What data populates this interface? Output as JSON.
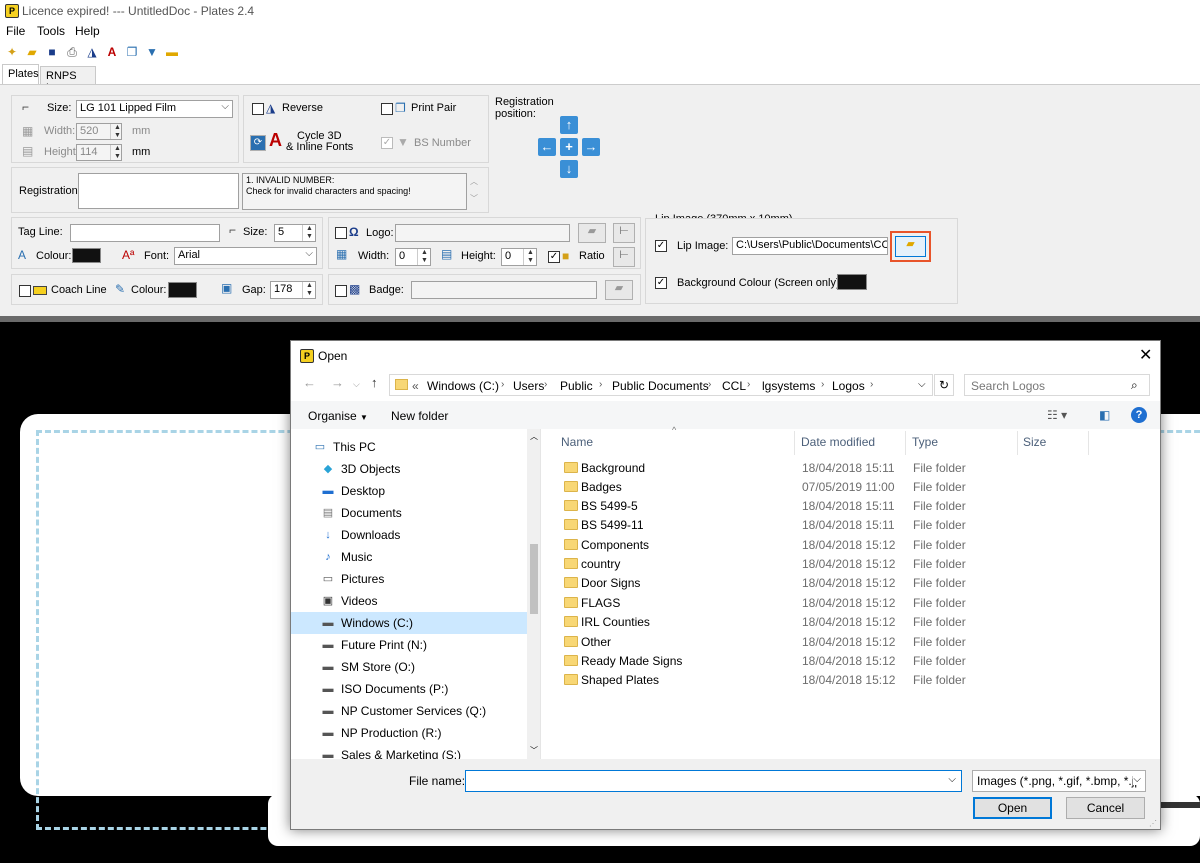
{
  "app": {
    "title": "Licence expired! --- UntitledDoc - Plates 2.4",
    "icon_letter": "P",
    "menu": [
      "File",
      "Tools",
      "Help"
    ]
  },
  "tabs": [
    "Plates",
    "RNPS Log"
  ],
  "plate_settings": {
    "size_label": "Size:",
    "size_value": "LG 101 Lipped Film",
    "width_label": "Width:",
    "width_value": "520",
    "height_label": "Height:",
    "height_value": "114",
    "unit": "mm",
    "reverse_label": "Reverse",
    "print_pair_label": "Print Pair",
    "cycle_label_1": "Cycle 3D",
    "cycle_label_2": "& Inline Fonts",
    "bs_number_label": "BS Number",
    "registration_position_label_1": "Registration",
    "registration_position_label_2": "position:",
    "registration_label": "Registration:",
    "registration_value": "",
    "error_line_1": "1. INVALID NUMBER:",
    "error_line_2": "Check for invalid characters and spacing!",
    "tag_line_label": "Tag Line:",
    "tag_line_value": "",
    "tag_size_label": "Size:",
    "tag_size_value": "5",
    "colour_label": "Colour:",
    "font_label": "Font:",
    "font_value": "Arial",
    "coach_line_label": "Coach Line",
    "coach_colour_label": "Colour:",
    "gap_label": "Gap:",
    "gap_value": "178",
    "logo_label": "Logo:",
    "logo_width_label": "Width:",
    "logo_width_value": "0",
    "logo_height_label": "Height:",
    "logo_height_value": "0",
    "ratio_label": "Ratio",
    "badge_label": "Badge:",
    "lip_image_group": "Lip Image (370mm x 10mm)",
    "lip_image_label": "Lip Image:",
    "lip_image_path": "C:\\Users\\Public\\Documents\\CCL\\",
    "background_colour_label": "Background Colour (Screen only):",
    "swatch_color": "#111111"
  },
  "open_dialog": {
    "title": "Open",
    "breadcrumbs": [
      "«",
      "Windows (C:)",
      "Users",
      "Public",
      "Public Documents",
      "CCL",
      "lgsystems",
      "Logos"
    ],
    "search_placeholder": "Search Logos",
    "organise_label": "Organise",
    "new_folder_label": "New folder",
    "nav_items": [
      {
        "label": "This PC",
        "icon": "computer-icon"
      },
      {
        "label": "3D Objects",
        "icon": "cube-icon"
      },
      {
        "label": "Desktop",
        "icon": "desktop-icon"
      },
      {
        "label": "Documents",
        "icon": "document-icon"
      },
      {
        "label": "Downloads",
        "icon": "download-icon"
      },
      {
        "label": "Music",
        "icon": "music-icon"
      },
      {
        "label": "Pictures",
        "icon": "picture-icon"
      },
      {
        "label": "Videos",
        "icon": "video-icon"
      },
      {
        "label": "Windows (C:)",
        "icon": "drive-icon"
      },
      {
        "label": "Future Print (N:)",
        "icon": "network-drive-icon"
      },
      {
        "label": "SM Store (O:)",
        "icon": "network-drive-icon"
      },
      {
        "label": "ISO Documents (P:)",
        "icon": "network-drive-icon"
      },
      {
        "label": "NP Customer Services (Q:)",
        "icon": "network-drive-icon"
      },
      {
        "label": "NP Production (R:)",
        "icon": "network-drive-icon"
      },
      {
        "label": "Sales & Marketing (S:)",
        "icon": "network-drive-icon"
      }
    ],
    "columns": [
      "Name",
      "Date modified",
      "Type",
      "Size"
    ],
    "files": [
      {
        "name": "Background",
        "date": "18/04/2018 15:11",
        "type": "File folder"
      },
      {
        "name": "Badges",
        "date": "07/05/2019 11:00",
        "type": "File folder"
      },
      {
        "name": "BS 5499-5",
        "date": "18/04/2018 15:11",
        "type": "File folder"
      },
      {
        "name": "BS 5499-11",
        "date": "18/04/2018 15:11",
        "type": "File folder"
      },
      {
        "name": "Components",
        "date": "18/04/2018 15:12",
        "type": "File folder"
      },
      {
        "name": "country",
        "date": "18/04/2018 15:12",
        "type": "File folder"
      },
      {
        "name": "Door Signs",
        "date": "18/04/2018 15:12",
        "type": "File folder"
      },
      {
        "name": "FLAGS",
        "date": "18/04/2018 15:12",
        "type": "File folder"
      },
      {
        "name": "IRL Counties",
        "date": "18/04/2018 15:12",
        "type": "File folder"
      },
      {
        "name": "Other",
        "date": "18/04/2018 15:12",
        "type": "File folder"
      },
      {
        "name": "Ready Made Signs",
        "date": "18/04/2018 15:12",
        "type": "File folder"
      },
      {
        "name": "Shaped Plates",
        "date": "18/04/2018 15:12",
        "type": "File folder"
      }
    ],
    "file_name_label": "File name:",
    "file_name_value": "",
    "file_type_value": "Images (*.png, *.gif, *.bmp, *.jp",
    "open_label": "Open",
    "cancel_label": "Cancel"
  }
}
